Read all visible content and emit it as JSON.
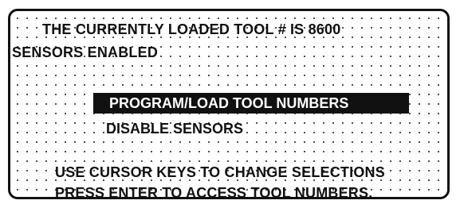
{
  "status": {
    "loaded_tool_line": "THE CURRENTLY LOADED TOOL # IS 8600",
    "sensors_line": "SENSORS ENABLED"
  },
  "menu": {
    "items": [
      {
        "label": "PROGRAM/LOAD TOOL NUMBERS",
        "selected": true
      },
      {
        "label": "DISABLE SENSORS",
        "selected": false
      }
    ]
  },
  "help": {
    "line_1": "USE CURSOR KEYS TO CHANGE SELECTIONS",
    "line_2": "PRESS ENTER TO ACCESS TOOL NUMBERS."
  },
  "colors": {
    "foreground": "#111111",
    "background": "#ffffff",
    "highlight": "#111111"
  }
}
